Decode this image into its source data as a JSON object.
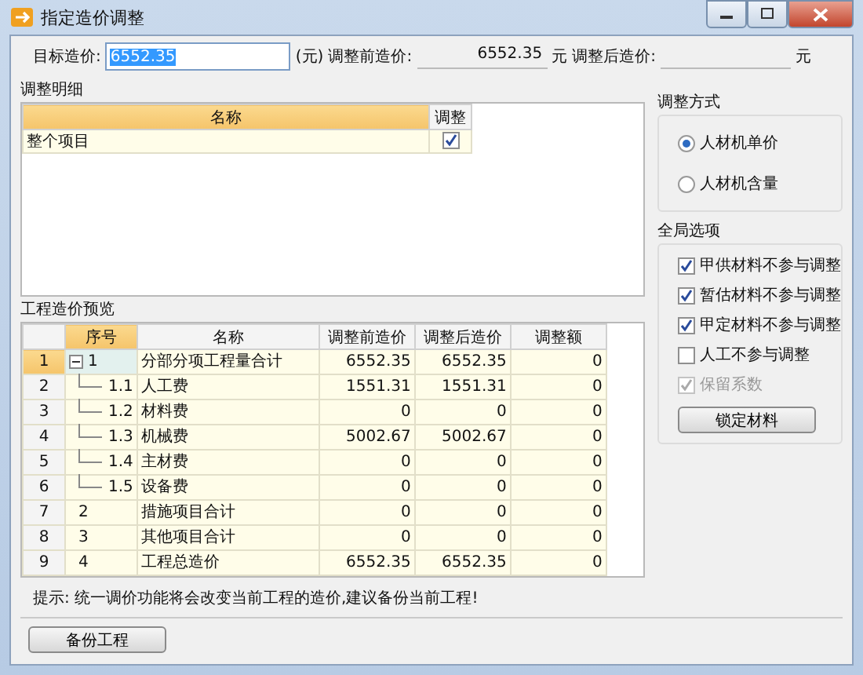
{
  "window": {
    "title": "指定造价调整"
  },
  "target": {
    "label": "目标造价:",
    "value": "6552.35",
    "unit": "(元)"
  },
  "before": {
    "label": "调整前造价:",
    "value": "6552.35",
    "unit": "元"
  },
  "after": {
    "label": "调整后造价:",
    "unit": "元"
  },
  "detail": {
    "title": "调整明细",
    "columns": [
      "名称",
      "调整"
    ],
    "rows": [
      {
        "name": "整个项目",
        "checked": true
      }
    ]
  },
  "preview": {
    "title": "工程造价预览",
    "columns": [
      "序号",
      "名称",
      "调整前造价",
      "调整后造价",
      "调整额"
    ],
    "rows": [
      {
        "row": "1",
        "seq": "1",
        "name": "分部分项工程量合计",
        "before": "6552.35",
        "after": "6552.35",
        "diff": "0",
        "selected": true,
        "expanded": true,
        "children": [
          {
            "row": "2",
            "seq": "1.1",
            "name": "人工费",
            "before": "1551.31",
            "after": "1551.31",
            "diff": "0",
            "selected": false
          },
          {
            "row": "3",
            "seq": "1.2",
            "name": "材料费",
            "before": "0",
            "after": "0",
            "diff": "0",
            "selected": false
          },
          {
            "row": "4",
            "seq": "1.3",
            "name": "机械费",
            "before": "5002.67",
            "after": "5002.67",
            "diff": "0",
            "selected": false
          },
          {
            "row": "5",
            "seq": "1.4",
            "name": "主材费",
            "before": "0",
            "after": "0",
            "diff": "0",
            "selected": false
          },
          {
            "row": "6",
            "seq": "1.5",
            "name": "设备费",
            "before": "0",
            "after": "0",
            "diff": "0",
            "selected": false
          }
        ]
      },
      {
        "row": "7",
        "seq": "2",
        "name": "措施项目合计",
        "before": "0",
        "after": "0",
        "diff": "0",
        "selected": false
      },
      {
        "row": "8",
        "seq": "3",
        "name": "其他项目合计",
        "before": "0",
        "after": "0",
        "diff": "0",
        "selected": false
      },
      {
        "row": "9",
        "seq": "4",
        "name": "工程总造价",
        "before": "6552.35",
        "after": "6552.35",
        "diff": "0",
        "selected": false
      }
    ]
  },
  "method": {
    "title": "调整方式",
    "options": [
      {
        "label": "人材机单价",
        "selected": true
      },
      {
        "label": "人材机含量",
        "selected": false
      }
    ]
  },
  "global": {
    "title": "全局选项",
    "options": [
      {
        "label": "甲供材料不参与调整",
        "checked": true,
        "disabled": false
      },
      {
        "label": "暂估材料不参与调整",
        "checked": true,
        "disabled": false
      },
      {
        "label": "甲定材料不参与调整",
        "checked": true,
        "disabled": false
      },
      {
        "label": "人工不参与调整",
        "checked": false,
        "disabled": false
      },
      {
        "label": "保留系数",
        "checked": true,
        "disabled": true
      }
    ],
    "button": "锁定材料"
  },
  "hint": "提示: 统一调价功能将会改变当前工程的造价,建议备份当前工程!",
  "backup_button": "备份工程"
}
